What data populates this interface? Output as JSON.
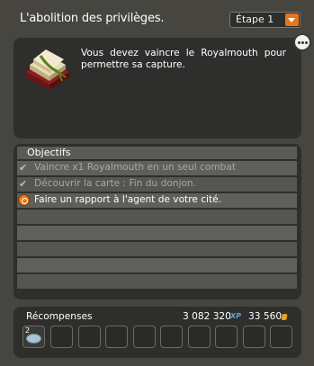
{
  "quest": {
    "title": "L'abolition des privilèges.",
    "step_selector": {
      "selected": "Étape 1"
    },
    "description": "Vous devez vaincre le Royalmouth pour permettre sa capture.",
    "image_icon": "scroll-quest-icon",
    "more_icon": "ellipsis-icon"
  },
  "objectives": {
    "header": "Objectifs",
    "items": [
      {
        "status": "done",
        "status_icon": "checkmark-icon",
        "text": "Vaincre x1 Royalmouth en un seul combat"
      },
      {
        "status": "done",
        "status_icon": "checkmark-icon",
        "text": "Découvrir la carte : Fin du donjon."
      },
      {
        "status": "active",
        "status_icon": "orange-objective-icon",
        "text": "Faire un rapport à l'agent de votre cité."
      }
    ]
  },
  "rewards": {
    "label": "Récompenses",
    "xp": "3 082 320",
    "xp_unit": "XP",
    "kamas": "33 560",
    "kamas_icon": "kamas-icon",
    "items": [
      {
        "quantity": "2",
        "icon": "resource-item-icon"
      }
    ]
  },
  "colors": {
    "window_bg": "#46453f",
    "panel_bg": "#2e2e2c",
    "accent_orange": "#e8771a",
    "xp_blue": "#5aa6d8"
  }
}
